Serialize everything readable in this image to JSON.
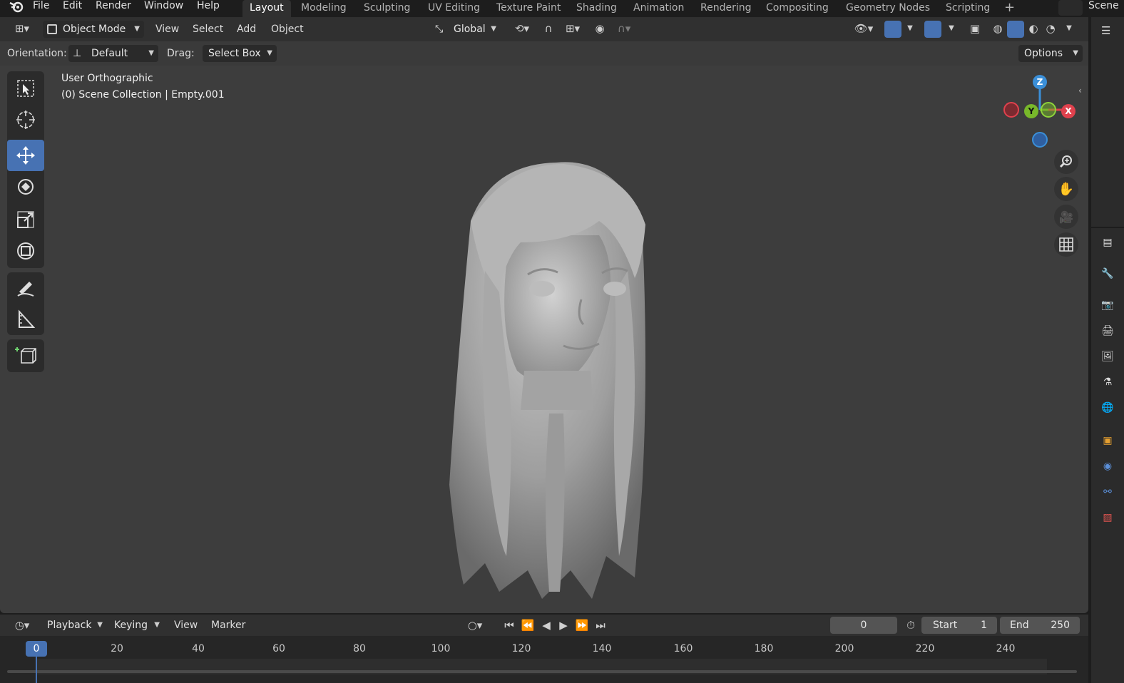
{
  "menu": {
    "items": [
      "File",
      "Edit",
      "Render",
      "Window",
      "Help"
    ],
    "scene_label": "Scene"
  },
  "workspaces": [
    "Layout",
    "Modeling",
    "Sculpting",
    "UV Editing",
    "Texture Paint",
    "Shading",
    "Animation",
    "Rendering",
    "Compositing",
    "Geometry Nodes",
    "Scripting"
  ],
  "viewport_header": {
    "mode": "Object Mode",
    "menus": [
      "View",
      "Select",
      "Add",
      "Object"
    ],
    "transform_orientation": "Global"
  },
  "tool_settings": {
    "orientation_label": "Orientation:",
    "orientation_value": "Default",
    "drag_label": "Drag:",
    "drag_value": "Select Box",
    "options_label": "Options"
  },
  "viewport_overlay": {
    "view_name": "User Orthographic",
    "collection_info": "(0) Scene Collection | Empty.001"
  },
  "gizmo": {
    "z": "Z",
    "y": "Y",
    "x": "X",
    "colors": {
      "x": "#e0414d",
      "y": "#78b82a",
      "z": "#3b8fd8"
    }
  },
  "timeline": {
    "menus": [
      "Playback",
      "Keying",
      "View",
      "Marker"
    ],
    "current_frame": "0",
    "start_label": "Start",
    "start_value": "1",
    "end_label": "End",
    "end_value": "250",
    "ticks": [
      "20",
      "40",
      "60",
      "80",
      "100",
      "120",
      "140",
      "160",
      "180",
      "200",
      "220",
      "240"
    ],
    "playhead": "0"
  },
  "colors": {
    "accent": "#4772b3",
    "viewport_bg": "#3d3d3d",
    "header_bg": "#303030"
  }
}
